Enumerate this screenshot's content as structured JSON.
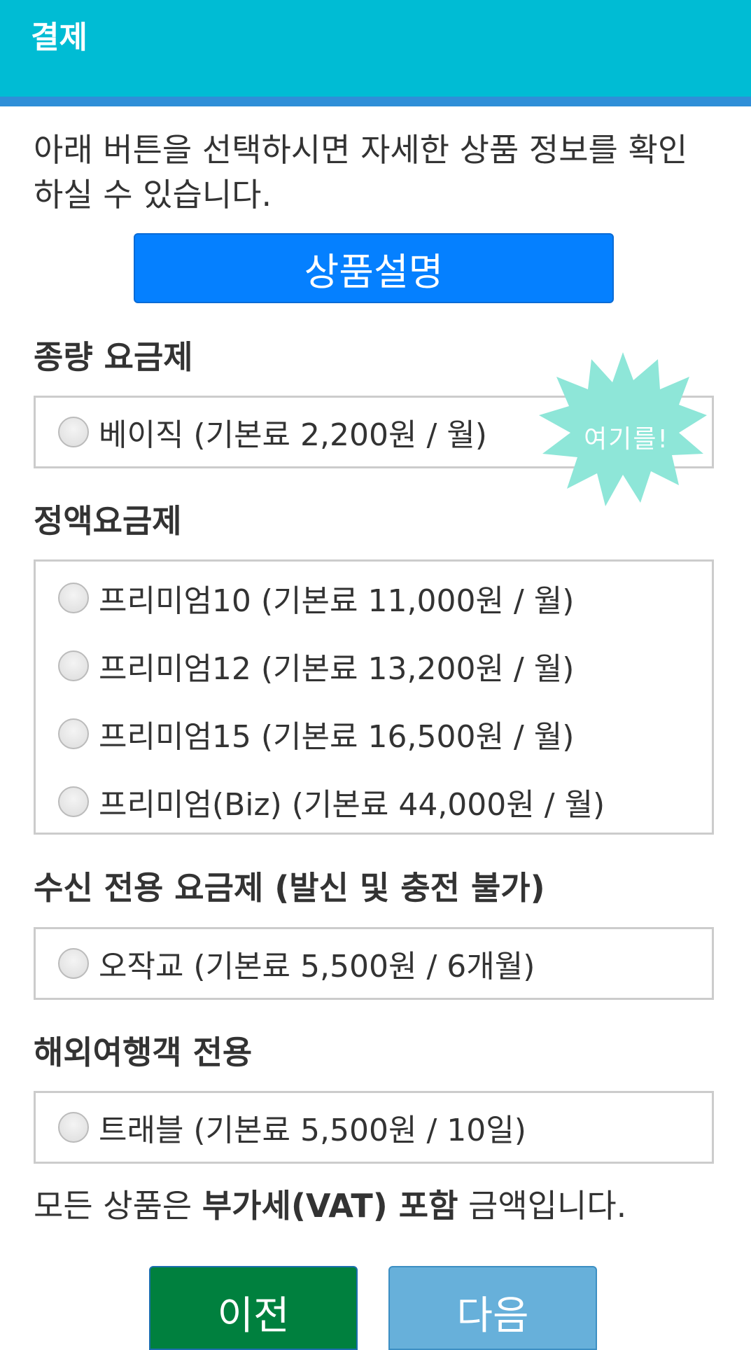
{
  "header": {
    "title": "결제"
  },
  "intro": {
    "text": "아래 버튼을 선택하시면 자세한 상품 정보를 확인 하실 수 있습니다."
  },
  "detail_button": {
    "label": "상품설명"
  },
  "sections": {
    "flat": {
      "title": "종량 요금제",
      "options": [
        "베이직 (기본료 2,200원 / 월)"
      ]
    },
    "fixed": {
      "title": "정액요금제",
      "options": [
        "프리미엄10 (기본료 11,000원 / 월)",
        "프리미엄12 (기본료 13,200원 / 월)",
        "프리미엄15 (기본료 16,500원 / 월)",
        "프리미엄(Biz) (기본료 44,000원 / 월)"
      ]
    },
    "receive_only": {
      "title": "수신 전용 요금제 (발신 및 충전 불가)",
      "options": [
        "오작교 (기본료 5,500원 / 6개월)"
      ]
    },
    "travel": {
      "title": "해외여행객 전용",
      "options": [
        "트래블 (기본료 5,500원 / 10일)"
      ]
    }
  },
  "sticker": {
    "text": "여기를!",
    "color": "#8ee6d8"
  },
  "vat_notice": {
    "prefix": "모든 상품은 ",
    "bold": "부가세(VAT) 포함",
    "suffix": " 금액입니다."
  },
  "nav": {
    "prev_label": "이전",
    "next_label": "다음"
  },
  "colors": {
    "header": "#00bcd4",
    "header_stripe": "#2f8fd8",
    "detail_button": "#0580ff",
    "prev_button": "#00803e",
    "next_button": "#67b0da"
  }
}
